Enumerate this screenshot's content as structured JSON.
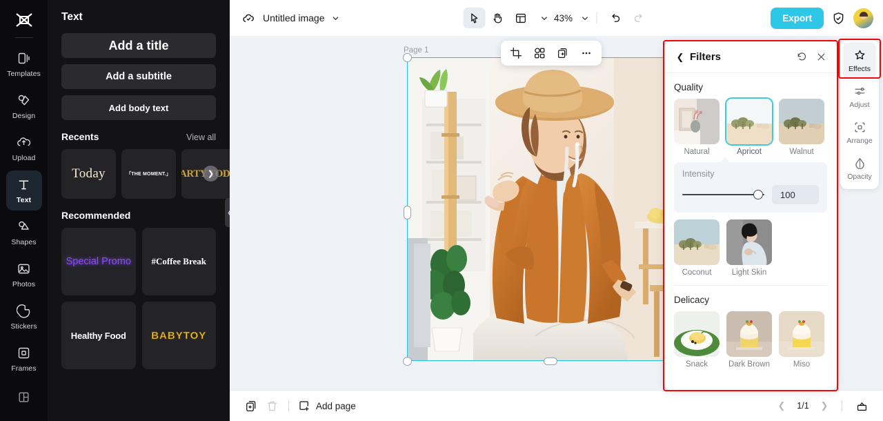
{
  "rail": {
    "logo_icon": "capcut-logo-icon",
    "items": [
      {
        "label": "Templates",
        "icon": "templates-icon",
        "active": false
      },
      {
        "label": "Design",
        "icon": "design-icon",
        "active": false
      },
      {
        "label": "Upload",
        "icon": "upload-cloud-icon",
        "active": false
      },
      {
        "label": "Text",
        "icon": "text-t-icon",
        "active": true
      },
      {
        "label": "Shapes",
        "icon": "shapes-icon",
        "active": false
      },
      {
        "label": "Photos",
        "icon": "photos-icon",
        "active": false
      },
      {
        "label": "Stickers",
        "icon": "stickers-icon",
        "active": false
      },
      {
        "label": "Frames",
        "icon": "frames-icon",
        "active": false
      },
      {
        "label": "",
        "icon": "layout-grid-icon",
        "active": false
      }
    ]
  },
  "panel": {
    "title": "Text",
    "buttons": [
      {
        "label": "Add a title"
      },
      {
        "label": "Add a subtitle"
      },
      {
        "label": "Add body text"
      }
    ],
    "recents": {
      "heading": "Recents",
      "view_all": "View all",
      "next_icon": "chevron-right-icon",
      "items": [
        {
          "text": "Today"
        },
        {
          "text": "「THE MOMENT.」"
        },
        {
          "text": "PARTY TODAY"
        }
      ]
    },
    "recommended": {
      "heading": "Recommended",
      "items": [
        {
          "text": "Special Promo"
        },
        {
          "text": "#Coffee Break"
        },
        {
          "text": "Healthy Food"
        },
        {
          "text": "BABYTOY"
        }
      ]
    },
    "collapse_icon": "chevron-left-icon"
  },
  "topbar": {
    "cloud_icon": "cloud-saved-icon",
    "doc_title": "Untitled image",
    "title_caret_icon": "chevron-down-icon",
    "tools": [
      {
        "name": "select-tool",
        "icon": "cursor-arrow-icon",
        "selected": true
      },
      {
        "name": "hand-tool",
        "icon": "hand-icon",
        "selected": false
      },
      {
        "name": "layout-tool",
        "icon": "layout-icon",
        "selected": false
      }
    ],
    "layout_caret_icon": "chevron-down-icon",
    "zoom": "43%",
    "zoom_caret_icon": "chevron-down-icon",
    "undo_icon": "undo-icon",
    "redo_icon": "redo-icon",
    "export_label": "Export",
    "shield_icon": "shield-icon",
    "avatar": "user-avatar"
  },
  "canvas": {
    "page_label": "Page 1",
    "float_toolbar": [
      {
        "name": "crop-button",
        "icon": "crop-icon"
      },
      {
        "name": "cutout-button",
        "icon": "cutout-shapes-icon"
      },
      {
        "name": "duplicate-button",
        "icon": "duplicate-icon"
      },
      {
        "name": "more-button",
        "icon": "more-dots-icon"
      }
    ],
    "selection_color": "#22c3dd"
  },
  "bottombar": {
    "duplicate_page_icon": "duplicate-page-icon",
    "delete_page_icon": "trash-icon",
    "add_page_label": "Add page",
    "add_page_icon": "add-page-icon",
    "prev_icon": "chevron-left-icon",
    "page_indicator": "1/1",
    "next_icon": "chevron-right-icon",
    "notes_icon": "notes-icon"
  },
  "filters": {
    "back_icon": "chevron-left-icon",
    "title": "Filters",
    "reset_icon": "reset-icon",
    "close_icon": "close-icon",
    "highlight_color": "#ef0808",
    "sections": [
      {
        "title": "Quality",
        "rows": [
          [
            {
              "label": "Natural",
              "selected": false,
              "thumb": "natural-thumb"
            },
            {
              "label": "Apricot",
              "selected": true,
              "thumb": "apricot-thumb"
            },
            {
              "label": "Walnut",
              "selected": false,
              "thumb": "walnut-thumb"
            }
          ],
          [
            {
              "label": "Coconut",
              "selected": false,
              "thumb": "coconut-thumb"
            },
            {
              "label": "Light Skin",
              "selected": false,
              "thumb": "lightskin-thumb"
            }
          ]
        ]
      },
      {
        "title": "Delicacy",
        "rows": [
          [
            {
              "label": "Snack",
              "selected": false,
              "thumb": "snack-thumb"
            },
            {
              "label": "Dark Brown",
              "selected": false,
              "thumb": "darkbrown-thumb"
            },
            {
              "label": "Miso",
              "selected": false,
              "thumb": "miso-thumb"
            }
          ]
        ]
      }
    ],
    "intensity": {
      "label": "Intensity",
      "value": "100"
    }
  },
  "right_strip": {
    "items": [
      {
        "label": "Effects",
        "icon": "effects-star-icon",
        "active": true
      },
      {
        "label": "Adjust",
        "icon": "adjust-sliders-icon",
        "active": false
      },
      {
        "label": "Arrange",
        "icon": "arrange-icon",
        "active": false
      },
      {
        "label": "Opacity",
        "icon": "opacity-drop-icon",
        "active": false
      }
    ]
  }
}
